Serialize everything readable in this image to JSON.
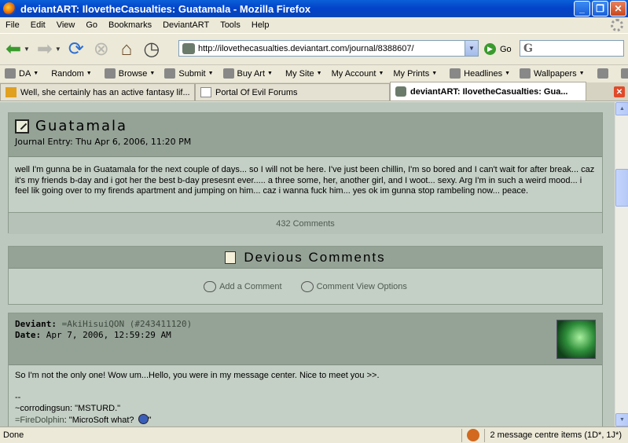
{
  "window": {
    "title": "deviantART: IlovetheCasualties: Guatamala - Mozilla Firefox"
  },
  "menu": [
    "File",
    "Edit",
    "View",
    "Go",
    "Bookmarks",
    "DeviantART",
    "Tools",
    "Help"
  ],
  "nav": {
    "url": "http://ilovethecasualties.deviantart.com/journal/8388607/",
    "go_label": "Go",
    "search_value": ""
  },
  "bookmarks": [
    "DA",
    "Random",
    "Browse",
    "Submit",
    "Buy Art",
    "My Site",
    "My Account",
    "My Prints",
    "Headlines",
    "Wallpapers"
  ],
  "tabs": [
    {
      "label": "Well, she certainly has an active fantasy lif...",
      "icon": "gaff-icon"
    },
    {
      "label": "Portal Of Evil Forums",
      "icon": "page-icon"
    },
    {
      "label": "deviantART: IlovetheCasualties: Gua...",
      "icon": "deviantart-icon"
    }
  ],
  "journal": {
    "title": "Guatamala",
    "date": "Journal Entry: Thu Apr 6, 2006, 11:20 PM",
    "body": "well I'm gunna be in Guatamala for the next couple of days... so I will not be here. I've just been chillin, I'm so bored and I can't wait for after break... caz it's my friends b-day and i got her the best b-day presesnt ever..... a three some, her, another girl, and I woot... sexy. Arg I'm in such a weird mood... i feel lik going over to my firends apartment and jumping on him... caz i wanna fuck him... yes ok im gunna stop rambeling now... peace.",
    "comments_count": "432 Comments"
  },
  "devious": {
    "title": "Devious Comments",
    "add_comment": "Add a Comment",
    "view_options": "Comment View Options"
  },
  "comment": {
    "deviant_label": "Deviant:",
    "deviant_name": "=AkiHisuiQON",
    "comment_id": "(#243411120)",
    "date_label": "Date:",
    "date": "Apr 7, 2006, 12:59:29 AM",
    "lines": [
      "So I'm not the only one! Wow um...Hello, you were in my message center. Nice to meet you >>.",
      "",
      "--",
      "~corrodingsun: \"MSTURD.\""
    ],
    "sig_user": "=FireDolphin",
    "sig_text": ": \"MicroSoft what?",
    "sig_end": "\""
  },
  "status": {
    "text": "Done",
    "messages": "2 message centre items (1D*, 1J*)"
  }
}
